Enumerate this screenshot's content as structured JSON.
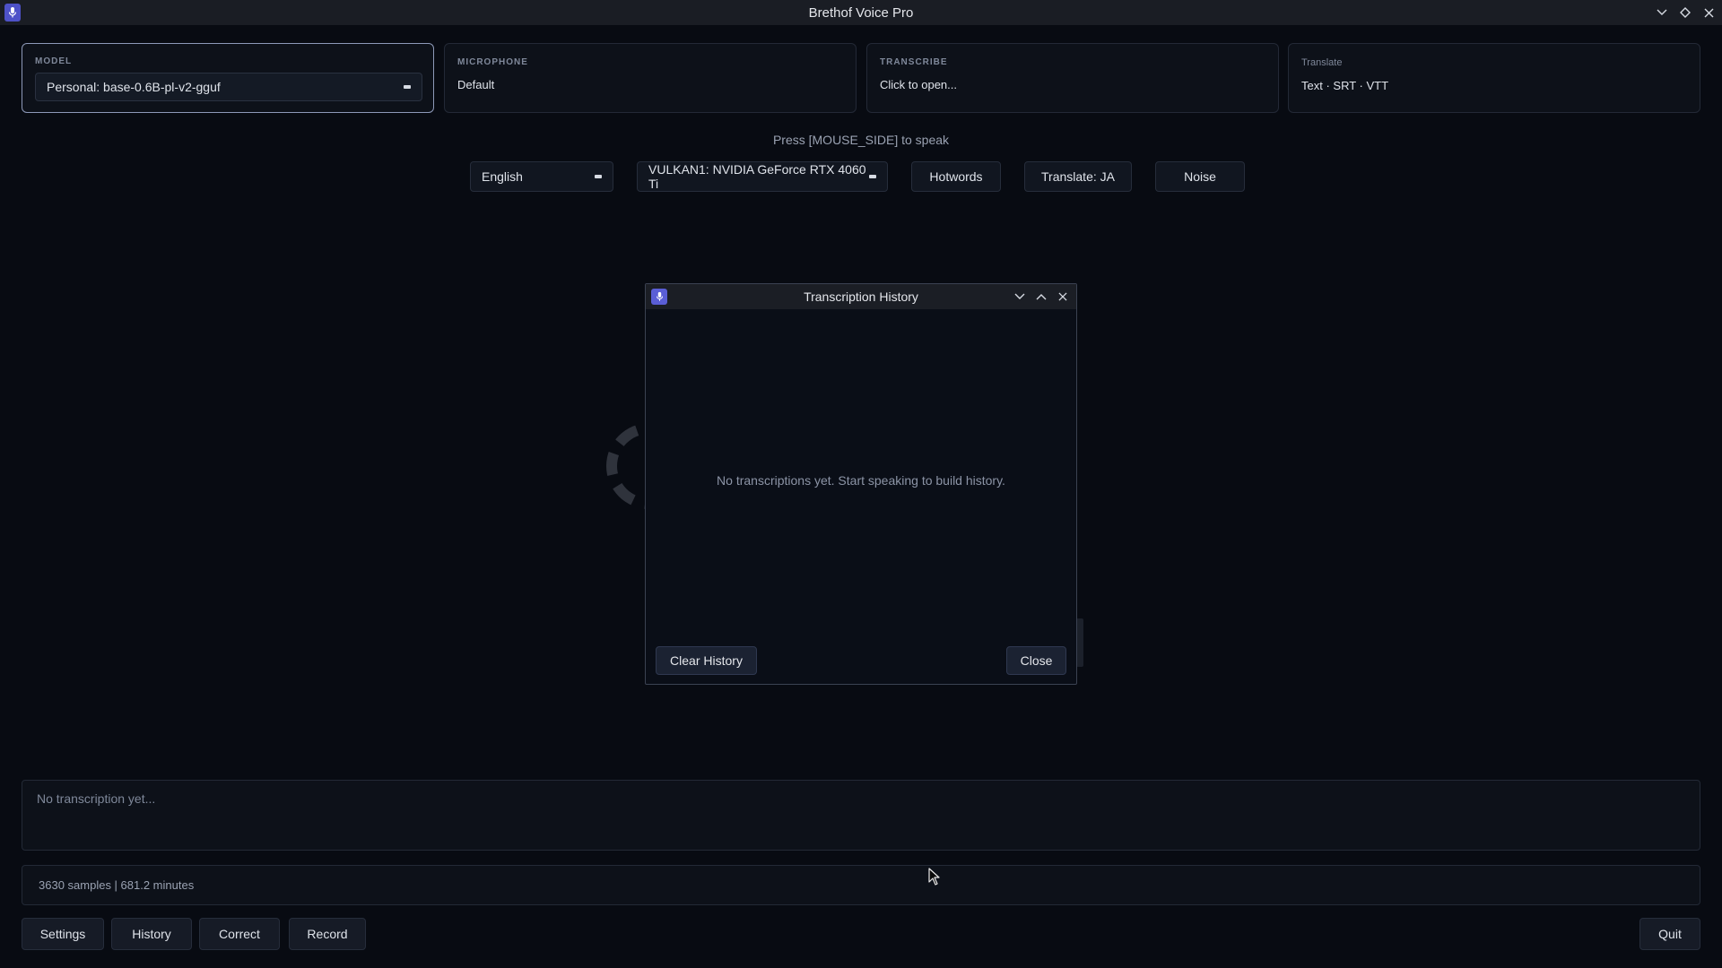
{
  "window": {
    "title": "Brethof Voice Pro"
  },
  "cards": {
    "model": {
      "label": "MODEL",
      "value": "Personal: base-0.6B-pl-v2-gguf"
    },
    "microphone": {
      "label": "MICROPHONE",
      "value": "Default"
    },
    "transcribe": {
      "label": "TRANSCRIBE",
      "value": "Click to open..."
    },
    "translate": {
      "label": "Translate",
      "value": "Text · SRT · VTT"
    }
  },
  "hint": "Press [MOUSE_SIDE] to speak",
  "controls": {
    "language": "English",
    "device": "VULKAN1: NVIDIA GeForce RTX 4060 Ti",
    "hotwords": "Hotwords",
    "translate": "Translate: JA",
    "noise": "Noise"
  },
  "dialog": {
    "title": "Transcription History",
    "empty_message": "No transcriptions yet. Start speaking to build history.",
    "clear_label": "Clear History",
    "close_label": "Close"
  },
  "output": {
    "placeholder": "No transcription yet..."
  },
  "status": {
    "text": "3630 samples | 681.2 minutes"
  },
  "bottom": {
    "settings": "Settings",
    "history": "History",
    "correct": "Correct",
    "record": "Record",
    "quit": "Quit"
  },
  "colors": {
    "accent": "#5a5ed6",
    "background": "#080b12"
  },
  "icons": [
    "microphone-icon",
    "minimize-icon",
    "maximize-icon",
    "close-icon",
    "cursor-icon"
  ]
}
